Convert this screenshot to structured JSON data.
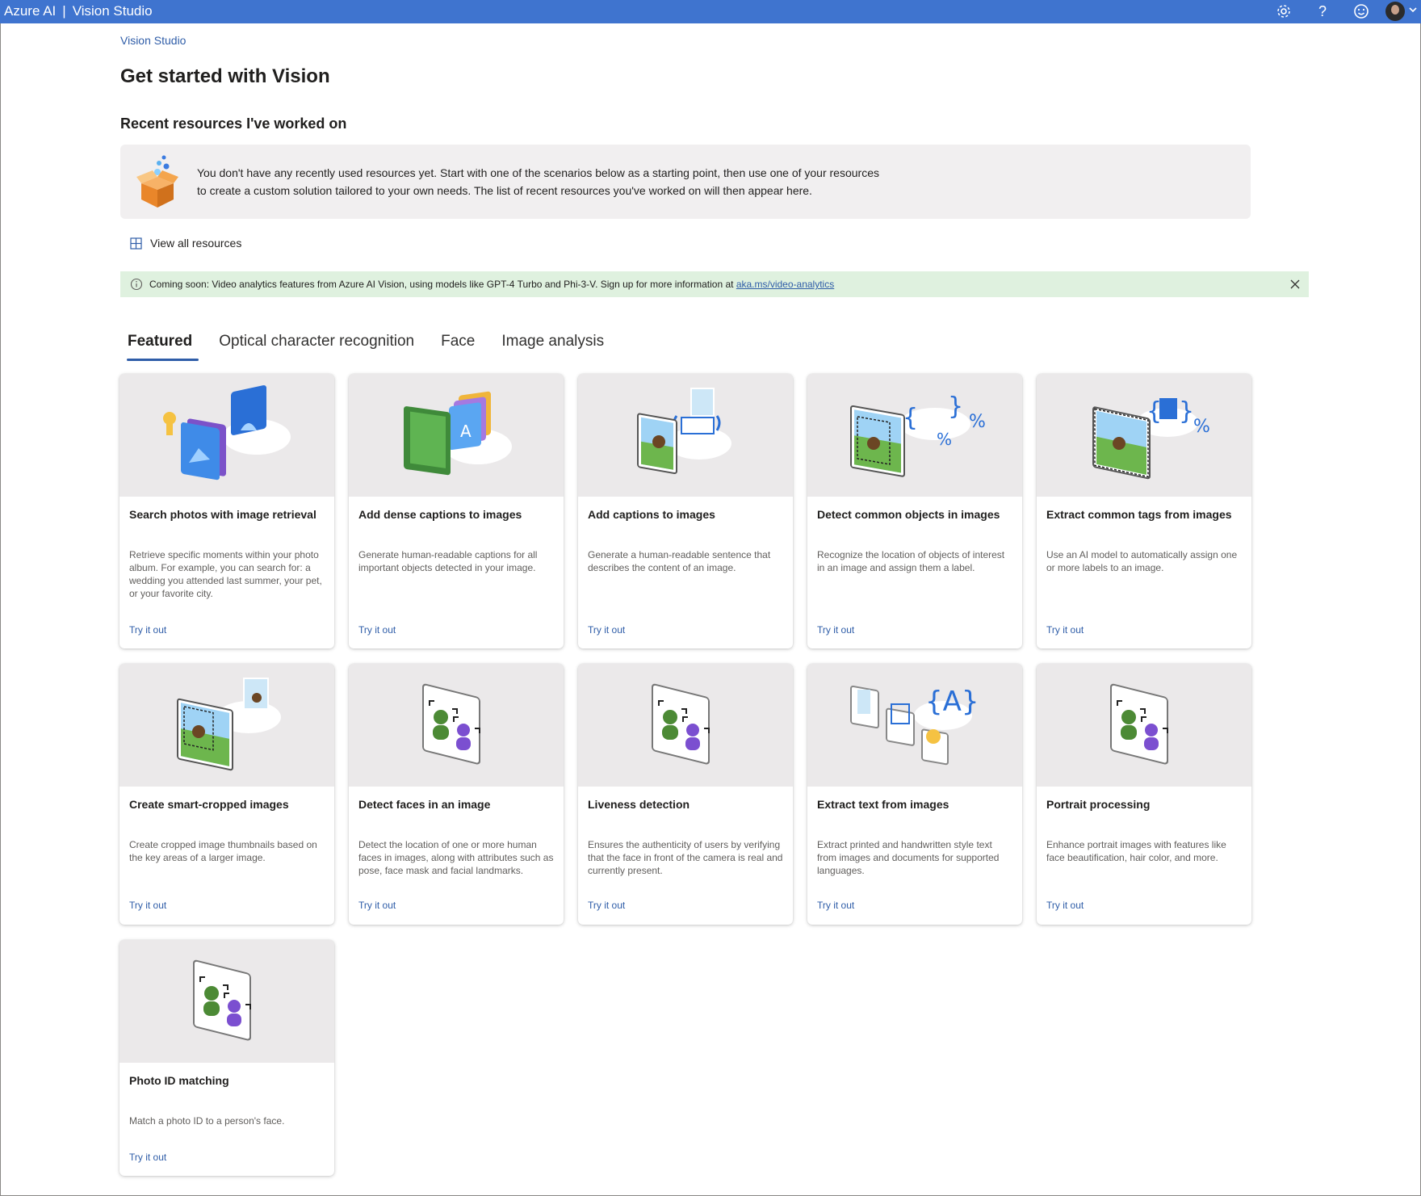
{
  "topbar": {
    "brand": "Azure AI",
    "separator": "|",
    "product": "Vision Studio",
    "icons": [
      "gear-icon",
      "help-icon",
      "feedback-smiley-icon",
      "avatar",
      "chevron-down-icon"
    ],
    "help_glyph": "?",
    "color": "#3f74cf"
  },
  "breadcrumb": "Vision Studio",
  "page_title": "Get started with Vision",
  "recent": {
    "heading": "Recent resources I've worked on",
    "message_line1": "You don't have any recently used resources yet. Start with one of the scenarios below as a starting point, then use one of your resources",
    "message_line2": "to create a custom solution tailored to your own needs. The list of recent resources you've worked on will then appear here."
  },
  "view_all": "View all resources",
  "banner": {
    "text": "Coming soon: Video analytics features from Azure AI Vision, using models like GPT-4 Turbo and Phi-3-V. Sign up for more information at ",
    "link": "aka.ms/video-analytics",
    "color": "#dff1df"
  },
  "tabs": [
    {
      "label": "Featured",
      "active": true
    },
    {
      "label": "Optical character recognition",
      "active": false
    },
    {
      "label": "Face",
      "active": false
    },
    {
      "label": "Image analysis",
      "active": false
    }
  ],
  "cards": [
    {
      "title": "Search photos with image retrieval",
      "desc": "Retrieve specific moments within your photo album. For example, you can search for: a wedding you attended last summer, your pet, or your favorite city.",
      "cta": "Try it out"
    },
    {
      "title": "Add dense captions to images",
      "desc": "Generate human-readable captions for all important objects detected in your image.",
      "cta": "Try it out"
    },
    {
      "title": "Add captions to images",
      "desc": "Generate a human-readable sentence that describes the content of an image.",
      "cta": "Try it out"
    },
    {
      "title": "Detect common objects in images",
      "desc": "Recognize the location of objects of interest in an image and assign them a label.",
      "cta": "Try it out"
    },
    {
      "title": "Extract common tags from images",
      "desc": "Use an AI model to automatically assign one or more labels to an image.",
      "cta": "Try it out"
    },
    {
      "title": "Create smart-cropped images",
      "desc": "Create cropped image thumbnails based on the key areas of a larger image.",
      "cta": "Try it out"
    },
    {
      "title": "Detect faces in an image",
      "desc": "Detect the location of one or more human faces in images, along with attributes such as pose, face mask and facial landmarks.",
      "cta": "Try it out"
    },
    {
      "title": "Liveness detection",
      "desc": "Ensures the authenticity of users by verifying that the face in front of the camera is real and currently present.",
      "cta": "Try it out"
    },
    {
      "title": "Extract text from images",
      "desc": "Extract printed and handwritten style text from images and documents for supported languages.",
      "cta": "Try it out"
    },
    {
      "title": "Portrait processing",
      "desc": "Enhance portrait images with features like face beautification, hair color, and more.",
      "cta": "Try it out"
    },
    {
      "title": "Photo ID matching",
      "desc": "Match a photo ID to a person's face.",
      "cta": "Try it out"
    }
  ],
  "accent_color": "#2f5da8"
}
